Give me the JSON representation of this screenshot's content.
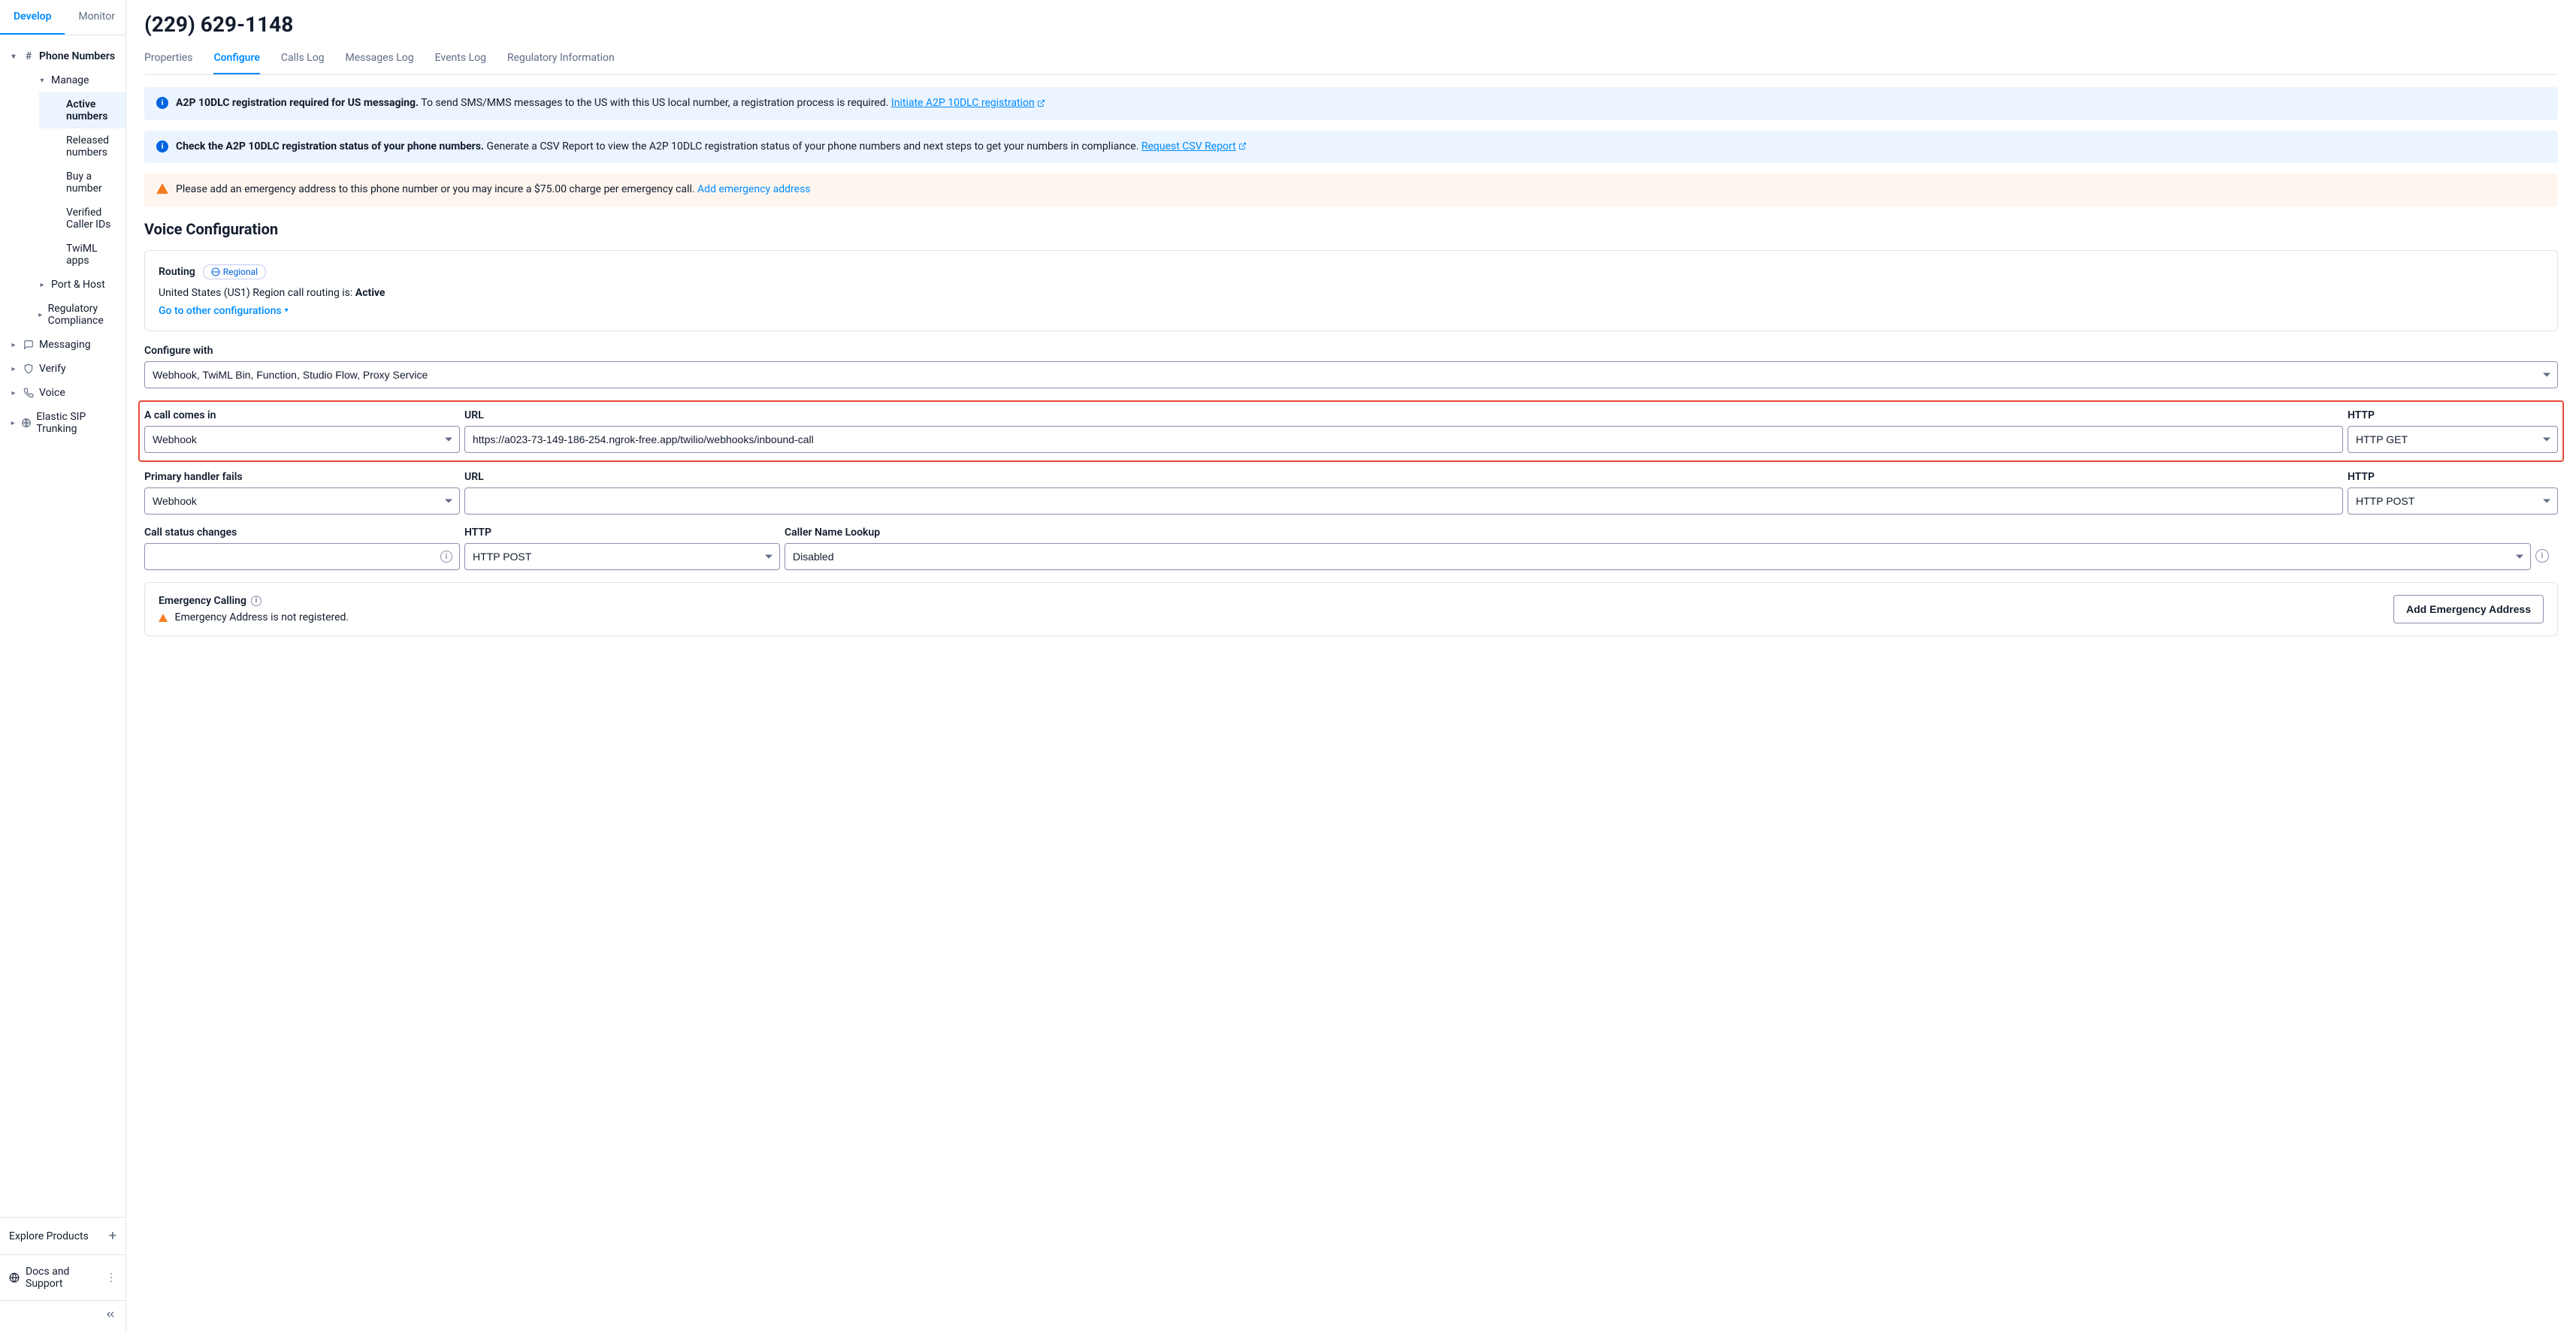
{
  "topTabs": {
    "develop": "Develop",
    "monitor": "Monitor"
  },
  "sidebar": {
    "phoneNumbers": "Phone Numbers",
    "manage": "Manage",
    "manageItems": {
      "active": "Active numbers",
      "released": "Released numbers",
      "buy": "Buy a number",
      "verified": "Verified Caller IDs",
      "twiml": "TwiML apps",
      "port": "Port & Host",
      "regulatory": "Regulatory Compliance"
    },
    "messaging": "Messaging",
    "verify": "Verify",
    "voice": "Voice",
    "elastic": "Elastic SIP Trunking",
    "explore": "Explore Products",
    "docs": "Docs and Support"
  },
  "header": {
    "title": "(229) 629-1148"
  },
  "tabs": {
    "properties": "Properties",
    "configure": "Configure",
    "callsLog": "Calls Log",
    "messagesLog": "Messages Log",
    "eventsLog": "Events Log",
    "regulatory": "Regulatory Information"
  },
  "banners": {
    "a2p": {
      "bold": "A2P 10DLC registration required for US messaging.",
      "text": " To send SMS/MMS messages to the US with this US local number, a registration process is required. ",
      "link": "Initiate A2P 10DLC registration"
    },
    "csv": {
      "bold": "Check the A2P 10DLC registration status of your phone numbers.",
      "text": " Generate a CSV Report to view the A2P 10DLC registration status of your phone numbers and next steps to get your numbers in compliance. ",
      "link": "Request CSV Report"
    },
    "emergency": {
      "text": "Please add an emergency address to this phone number or you may incure a $75.00 charge per emergency call. ",
      "link": "Add emergency address"
    }
  },
  "voice": {
    "sectionTitle": "Voice Configuration",
    "routing": "Routing",
    "regional": "Regional",
    "statusPrefix": "United States (US1) Region call routing is: ",
    "statusValue": "Active",
    "goto": "Go to other configurations",
    "configureWith": {
      "label": "Configure with",
      "value": "Webhook, TwiML Bin, Function, Studio Flow, Proxy Service"
    },
    "callComesIn": {
      "label": "A call comes in",
      "handler": "Webhook",
      "urlLabel": "URL",
      "url": "https://a023-73-149-186-254.ngrok-free.app/twilio/webhooks/inbound-call",
      "httpLabel": "HTTP",
      "http": "HTTP GET"
    },
    "primaryFails": {
      "label": "Primary handler fails",
      "handler": "Webhook",
      "urlLabel": "URL",
      "url": "",
      "httpLabel": "HTTP",
      "http": "HTTP POST"
    },
    "callStatus": {
      "label": "Call status changes",
      "value": "",
      "httpLabel": "HTTP",
      "http": "HTTP POST",
      "callerLabel": "Caller Name Lookup",
      "caller": "Disabled"
    },
    "emergency": {
      "title": "Emergency Calling",
      "msg": "Emergency Address is not registered.",
      "button": "Add Emergency Address"
    }
  }
}
